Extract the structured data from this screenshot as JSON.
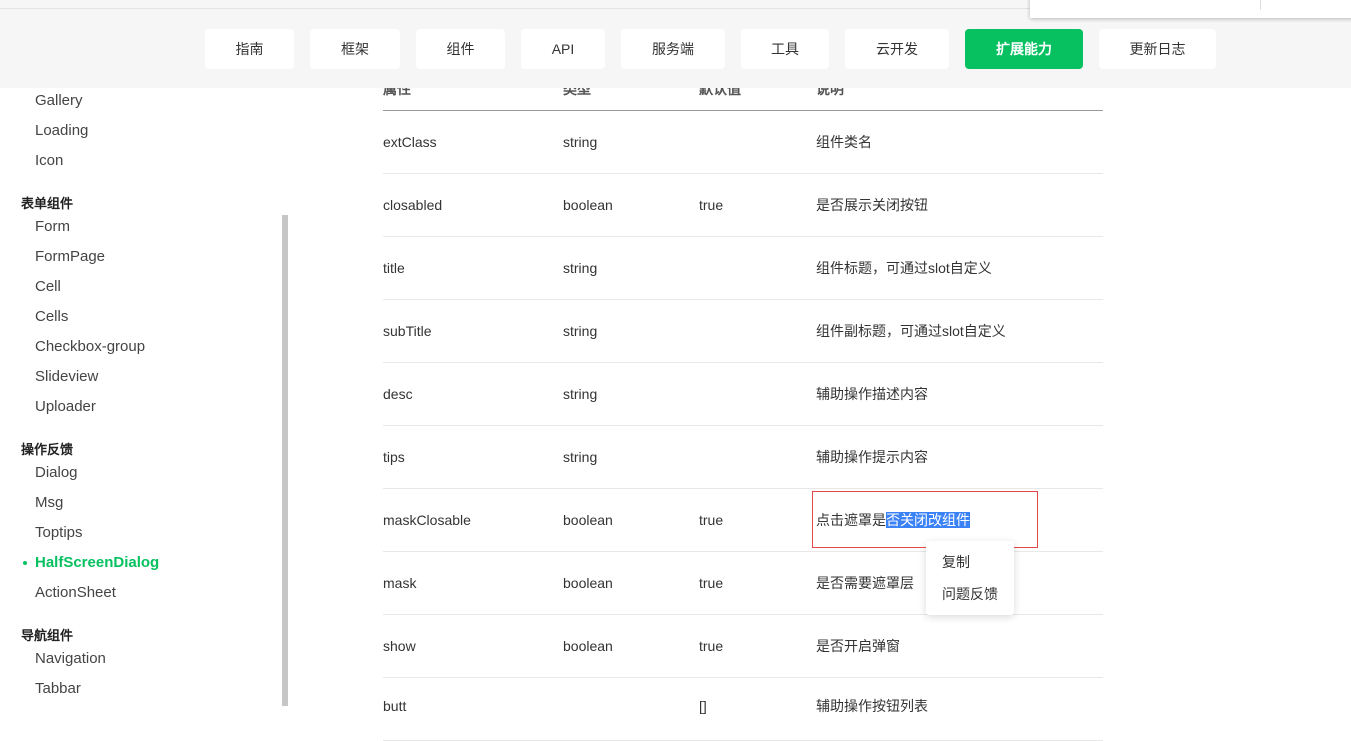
{
  "nav": [
    {
      "label": "指南",
      "active": false
    },
    {
      "label": "框架",
      "active": false
    },
    {
      "label": "组件",
      "active": false
    },
    {
      "label": "API",
      "active": false
    },
    {
      "label": "服务端",
      "active": false
    },
    {
      "label": "工具",
      "active": false
    },
    {
      "label": "云开发",
      "active": false
    },
    {
      "label": "扩展能力",
      "active": true
    },
    {
      "label": "更新日志",
      "active": false
    }
  ],
  "sidebar": {
    "items_top": [
      "Gallery",
      "Loading",
      "Icon"
    ],
    "group_form": "表单组件",
    "items_form": [
      "Form",
      "FormPage",
      "Cell",
      "Cells",
      "Checkbox-group",
      "Slideview",
      "Uploader"
    ],
    "group_feedback": "操作反馈",
    "items_feedback": [
      "Dialog",
      "Msg",
      "Toptips",
      "HalfScreenDialog",
      "ActionSheet"
    ],
    "active_item": "HalfScreenDialog",
    "group_nav": "导航组件",
    "items_nav": [
      "Navigation",
      "Tabbar"
    ]
  },
  "table": {
    "headers": [
      "属性",
      "类型",
      "默认值",
      "说明"
    ],
    "rows": [
      {
        "name": "extClass",
        "type": "string",
        "default": "",
        "desc": "组件类名"
      },
      {
        "name": "closabled",
        "type": "boolean",
        "default": "true",
        "desc": "是否展示关闭按钮"
      },
      {
        "name": "title",
        "type": "string",
        "default": "",
        "desc": "组件标题，可通过slot自定义"
      },
      {
        "name": "subTitle",
        "type": "string",
        "default": "",
        "desc": "组件副标题，可通过slot自定义"
      },
      {
        "name": "desc",
        "type": "string",
        "default": "",
        "desc": "辅助操作描述内容"
      },
      {
        "name": "tips",
        "type": "string",
        "default": "",
        "desc": "辅助操作提示内容"
      },
      {
        "name": "maskClosable",
        "type": "boolean",
        "default": "true",
        "desc_plain": "点击遮罩是",
        "desc_selected": "否关闭改组件"
      },
      {
        "name": "mask",
        "type": "boolean",
        "default": "true",
        "desc": "是否需要遮罩层"
      },
      {
        "name": "show",
        "type": "boolean",
        "default": "true",
        "desc": "是否开启弹窗"
      },
      {
        "name": "butt",
        "type": "",
        "default": "[]",
        "desc": "辅助操作按钮列表"
      }
    ]
  },
  "context_menu": {
    "copy": "复制",
    "feedback": "问题反馈"
  },
  "colors": {
    "accent": "#07c160",
    "selection": "#3b82f6",
    "selection_box": "#e34848"
  }
}
